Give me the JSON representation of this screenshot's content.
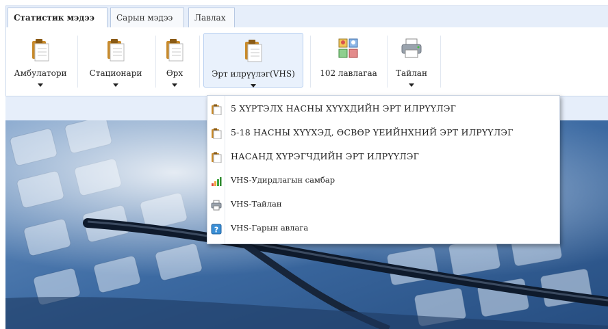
{
  "tabs": [
    {
      "label": "Статистик мэдээ",
      "active": true
    },
    {
      "label": "Сарын мэдээ",
      "active": false
    },
    {
      "label": "Лавлах",
      "active": false
    }
  ],
  "ribbon": {
    "buttons": [
      {
        "label": "Амбулатори",
        "icon": "clipboard-icon",
        "has_menu": true
      },
      {
        "label": "Стационари",
        "icon": "clipboard-icon",
        "has_menu": true
      },
      {
        "label": "Өрх",
        "icon": "clipboard-icon",
        "has_menu": true
      },
      {
        "label": "Эрт илрүүлэг(VHS)",
        "icon": "clipboard-icon",
        "has_menu": true,
        "selected": true
      },
      {
        "label": "102 лавлагаа",
        "icon": "directory-grid-icon",
        "has_menu": false
      },
      {
        "label": "Тайлан",
        "icon": "printer-icon",
        "has_menu": true
      }
    ]
  },
  "dropdown": {
    "items": [
      {
        "label": "5 ХҮРТЭЛХ НАСНЫ ХҮҮХДИЙН ЭРТ ИЛРҮҮЛЭГ",
        "icon": "clipboard-icon"
      },
      {
        "label": "5-18 НАСНЫ ХҮҮХЭД, ӨСВӨР ҮЕИЙНХНИЙ ЭРТ ИЛРҮҮЛЭГ",
        "icon": "clipboard-icon"
      },
      {
        "label": "НАСАНД ХҮРЭГЧДИЙН ЭРТ ИЛРҮҮЛЭГ",
        "icon": "clipboard-icon"
      },
      {
        "label": "VHS-Удирдлагын самбар",
        "icon": "bar-chart-icon"
      },
      {
        "label": "VHS-Тайлан",
        "icon": "printer-icon"
      },
      {
        "label": "VHS-Гарын авлага",
        "icon": "help-icon"
      }
    ]
  },
  "colors": {
    "tab_strip": "#e6eefa",
    "selected_button": "#e9f1fc",
    "banner_blue": "#2f5a8c"
  }
}
